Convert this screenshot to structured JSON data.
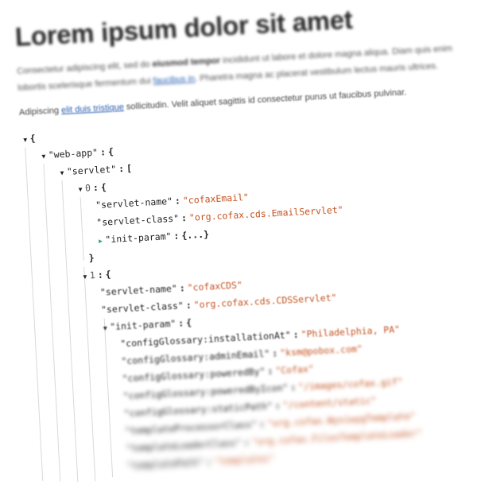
{
  "heading": "Lorem ipsum dolor sit amet",
  "paragraph1": {
    "part1": "Consectetur adipiscing elit, sed do ",
    "bold": "eiusmod tempor",
    "part2": " incididunt ut labore et dolore magna aliqua. Diam quis enim lobortis scelerisque fermentum dui ",
    "link": "faucibus in",
    "part3": ". Pharetra magna ac placerat vestibulum lectus mauris ultrices."
  },
  "paragraph2": {
    "part1": "Adipiscing ",
    "link": "elit duis tristique",
    "part2": " sollicitudin. Velit aliquet sagittis id consectetur purus ut faucibus pulvinar."
  },
  "json_view": {
    "open_brace": "{",
    "close_brace": "}",
    "colon": ":",
    "open_bracket": "[",
    "collapsed": "{...}",
    "web_app_key": "\"web-app\"",
    "servlet_key": "\"servlet\"",
    "item0": {
      "index": "0",
      "name_key": "\"servlet-name\"",
      "name_val": "\"cofaxEmail\"",
      "class_key": "\"servlet-class\"",
      "class_val": "\"org.cofax.cds.EmailServlet\"",
      "init_key": "\"init-param\""
    },
    "item1": {
      "index": "1",
      "name_key": "\"servlet-name\"",
      "name_val": "\"cofaxCDS\"",
      "class_key": "\"servlet-class\"",
      "class_val": "\"org.cofax.cds.CDSServlet\"",
      "init_key": "\"init-param\""
    },
    "params": [
      {
        "key": "\"configGlossary:installationAt\"",
        "val": "\"Philadelphia, PA\""
      },
      {
        "key": "\"configGlossary:adminEmail\"",
        "val": "\"ksm@pobox.com\""
      },
      {
        "key": "\"configGlossary:poweredBy\"",
        "val": "\"Cofax\""
      },
      {
        "key": "\"configGlossary:poweredByIcon\"",
        "val": "\"/images/cofax.gif\""
      },
      {
        "key": "\"configGlossary:staticPath\"",
        "val": "\"/content/static\""
      },
      {
        "key": "\"templateProcessorClass\"",
        "val": "\"org.cofax.WysiwygTemplate\""
      },
      {
        "key": "\"templateLoaderClass\"",
        "val": "\"org.cofax.FilesTemplateLoader\""
      },
      {
        "key": "\"templatePath\"",
        "val": "\"templates\""
      }
    ]
  }
}
